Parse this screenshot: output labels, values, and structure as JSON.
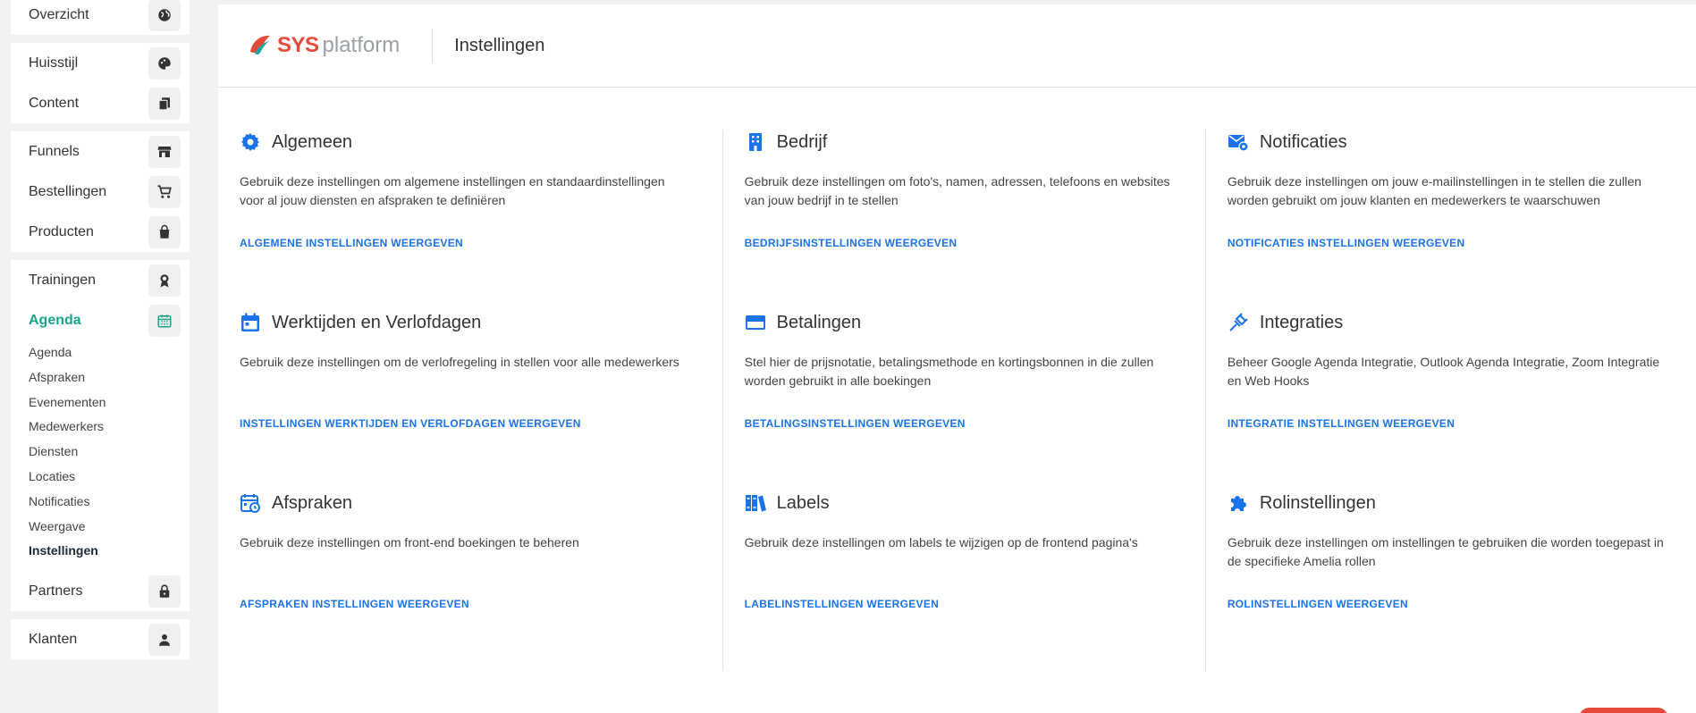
{
  "sidebar": {
    "groups": [
      {
        "items": [
          {
            "label": "Overzicht",
            "icon": "globe-icon"
          }
        ]
      },
      {
        "items": [
          {
            "label": "Huisstijl",
            "icon": "palette-icon"
          },
          {
            "label": "Content",
            "icon": "copy-icon"
          }
        ]
      },
      {
        "items": [
          {
            "label": "Funnels",
            "icon": "store-icon"
          },
          {
            "label": "Bestellingen",
            "icon": "cart-icon"
          },
          {
            "label": "Producten",
            "icon": "bag-icon"
          }
        ]
      }
    ],
    "trainingen": {
      "label": "Trainingen",
      "icon": "award-icon"
    },
    "agenda": {
      "label": "Agenda",
      "icon": "calendar-icon",
      "subs": [
        "Agenda",
        "Afspraken",
        "Evenementen",
        "Medewerkers",
        "Diensten",
        "Locaties",
        "Notificaties",
        "Weergave",
        "Instellingen"
      ],
      "active_sub": "Instellingen"
    },
    "partners": {
      "label": "Partners",
      "icon": "lock-icon"
    },
    "klanten": {
      "label": "Klanten",
      "icon": "user-icon"
    }
  },
  "header": {
    "logo_sys": "SYS",
    "logo_platform": "platform",
    "title": "Instellingen"
  },
  "cards": [
    {
      "title": "Algemeen",
      "icon": "gear-icon",
      "desc": "Gebruik deze instellingen om algemene instellingen en standaardinstellingen voor al jouw diensten en afspraken te definiëren",
      "link": "ALGEMENE INSTELLINGEN WEERGEVEN"
    },
    {
      "title": "Bedrijf",
      "icon": "building-icon",
      "desc": "Gebruik deze instellingen om foto's, namen, adressen, telefoons en websites van jouw bedrijf in te stellen",
      "link": "BEDRIJFSINSTELLINGEN WEERGEVEN"
    },
    {
      "title": "Notificaties",
      "icon": "mail-settings-icon",
      "desc": "Gebruik deze instellingen om jouw e-mailinstellingen in te stellen die zullen worden gebruikt om jouw klanten en medewerkers te waarschuwen",
      "link": "NOTIFICATIES INSTELLINGEN WEERGEVEN"
    },
    {
      "title": "Werktijden en Verlofdagen",
      "icon": "calendar-icon",
      "desc": "Gebruik deze instellingen om de verlofregeling in stellen voor alle medewerkers",
      "link": "INSTELLINGEN WERKTIJDEN EN VERLOFDAGEN WEERGEVEN"
    },
    {
      "title": "Betalingen",
      "icon": "credit-card-icon",
      "desc": "Stel hier de prijsnotatie, betalingsmethode en kortingsbonnen in die zullen worden gebruikt in alle boekingen",
      "link": "BETALINGSINSTELLINGEN WEERGEVEN"
    },
    {
      "title": "Integraties",
      "icon": "plug-icon",
      "desc": "Beheer Google Agenda Integratie, Outlook Agenda Integratie, Zoom Integratie en Web Hooks",
      "link": "INTEGRATIE INSTELLINGEN WEERGEVEN"
    },
    {
      "title": "Afspraken",
      "icon": "calendar-clock-icon",
      "desc": "Gebruik deze instellingen om front-end boekingen te beheren",
      "link": "AFSPRAKEN INSTELLINGEN WEERGEVEN"
    },
    {
      "title": "Labels",
      "icon": "books-icon",
      "desc": "Gebruik deze instellingen om labels te wijzigen op de frontend pagina's",
      "link": "LABELINSTELLINGEN WEERGEVEN"
    },
    {
      "title": "Rolinstellingen",
      "icon": "puzzle-icon",
      "desc": "Gebruik deze instellingen om instellingen te gebruiken die worden toegepast in de specifieke Amelia rollen",
      "link": "ROLINSTELLINGEN WEERGEVEN"
    }
  ],
  "colors": {
    "accent": "#1a73e8",
    "active": "#17a589",
    "brand": "#e34a3a"
  }
}
